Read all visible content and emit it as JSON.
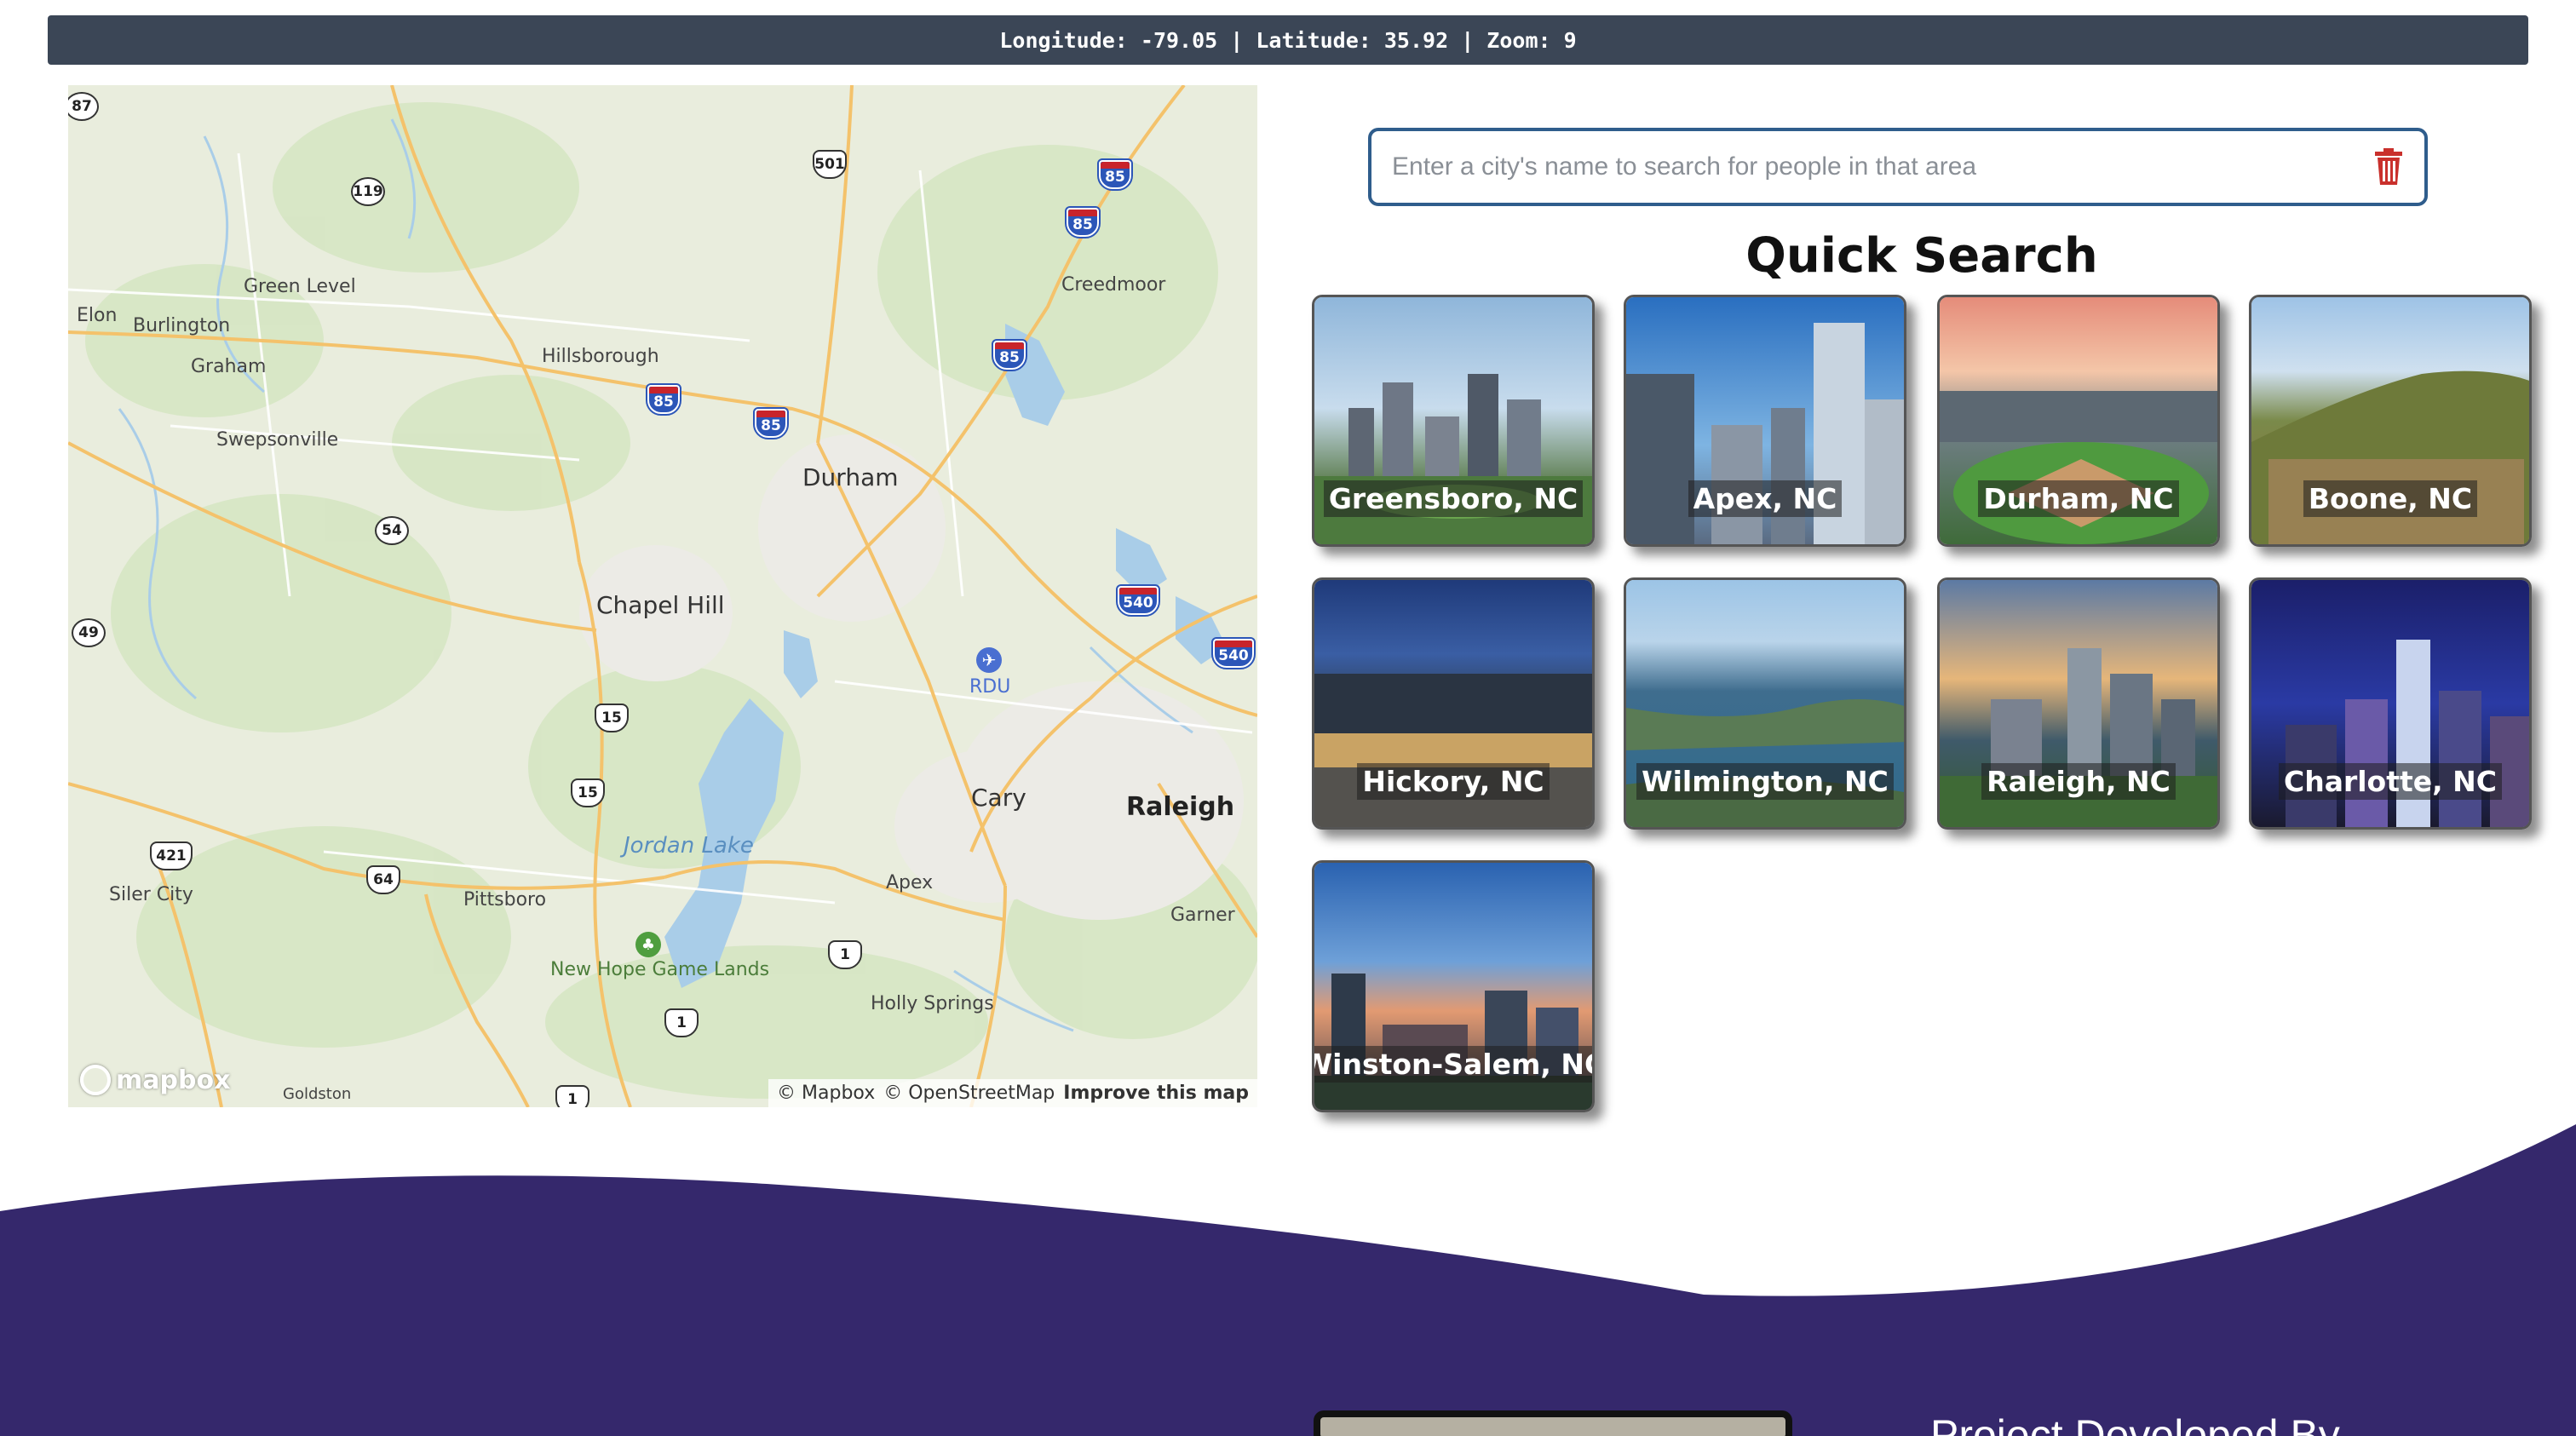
{
  "coords": {
    "text": "Longitude: -79.05 | Latitude: 35.92 | Zoom: 9"
  },
  "map": {
    "labels": {
      "elon": "Elon",
      "burlington": "Burlington",
      "green_level": "Green Level",
      "graham": "Graham",
      "swepsonville": "Swepsonville",
      "hillsborough": "Hillsborough",
      "creedmoor": "Creedmoor",
      "durham": "Durham",
      "chapel_hill": "Chapel Hill",
      "rdu": "RDU",
      "cary": "Cary",
      "raleigh": "Raleigh",
      "jordan_lake": "Jordan Lake",
      "siler_city": "Siler City",
      "pittsboro": "Pittsboro",
      "apex": "Apex",
      "garner": "Garner",
      "new_hope": "New Hope Game Lands",
      "holly_springs": "Holly Springs",
      "goldston": "Goldston"
    },
    "shields": {
      "s87": "87",
      "s119": "119",
      "s501": "501",
      "s85a": "85",
      "s85b": "85",
      "s85c": "85",
      "s85d": "85",
      "s85e": "85",
      "s54": "54",
      "s49": "49",
      "s15a": "15",
      "s15b": "15",
      "s540a": "540",
      "s540b": "540",
      "s421": "421",
      "s64": "64",
      "s1a": "1",
      "s1b": "1",
      "s1c": "1"
    },
    "logo": "mapbox",
    "attribution": {
      "mapbox": "© Mapbox",
      "osm": "© OpenStreetMap",
      "improve": "Improve this map"
    }
  },
  "search": {
    "placeholder": "Enter a city's name to search for people in that area"
  },
  "quick_search": {
    "title": "Quick Search",
    "cities": [
      {
        "label": "Greensboro, NC"
      },
      {
        "label": "Apex, NC"
      },
      {
        "label": "Durham, NC"
      },
      {
        "label": "Boone, NC"
      },
      {
        "label": "Hickory, NC"
      },
      {
        "label": "Wilmington, NC"
      },
      {
        "label": "Raleigh, NC"
      },
      {
        "label": "Charlotte, NC"
      },
      {
        "label": "Winston-Salem, NC"
      }
    ]
  },
  "footer": {
    "heading": "Project Developed By"
  },
  "colors": {
    "coord_bar": "#3b4656",
    "search_border": "#2f5d8c",
    "trash": "#c9302c",
    "footer_wave": "#35286c"
  }
}
